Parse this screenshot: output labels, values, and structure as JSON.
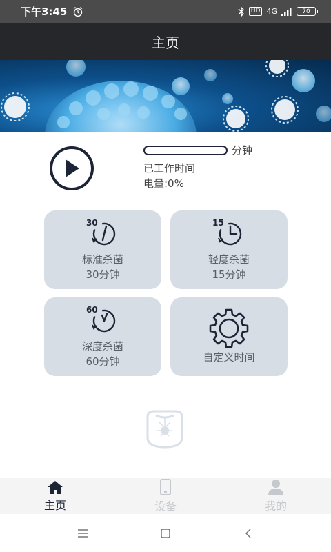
{
  "status_bar": {
    "time": "下午3:45",
    "network": "4G",
    "hd": "HD",
    "battery": "70"
  },
  "header": {
    "title": "主页"
  },
  "control": {
    "progress_fraction": 0,
    "progress_unit": "分钟",
    "worked_label": "已工作时间",
    "battery_label": "电量:0%"
  },
  "modes": [
    {
      "name": "标准杀菌",
      "time": "30分钟",
      "icon_number": "30",
      "icon": "timer-30-icon"
    },
    {
      "name": "轻度杀菌",
      "time": "15分钟",
      "icon_number": "15",
      "icon": "timer-15-icon"
    },
    {
      "name": "深度杀菌",
      "time": "60分钟",
      "icon_number": "60",
      "icon": "timer-60-icon"
    },
    {
      "name": "自定义时间",
      "icon": "gear-icon"
    }
  ],
  "bottom_nav": [
    {
      "label": "主页",
      "icon": "home-icon",
      "active": true
    },
    {
      "label": "设备",
      "icon": "phone-icon",
      "active": false
    },
    {
      "label": "我的",
      "icon": "person-icon",
      "active": false
    }
  ],
  "colors": {
    "title_bar": "#25272b",
    "card_bg": "#d7dde4",
    "nav_active": "#1c2436",
    "nav_inactive": "#c5c8cc"
  }
}
